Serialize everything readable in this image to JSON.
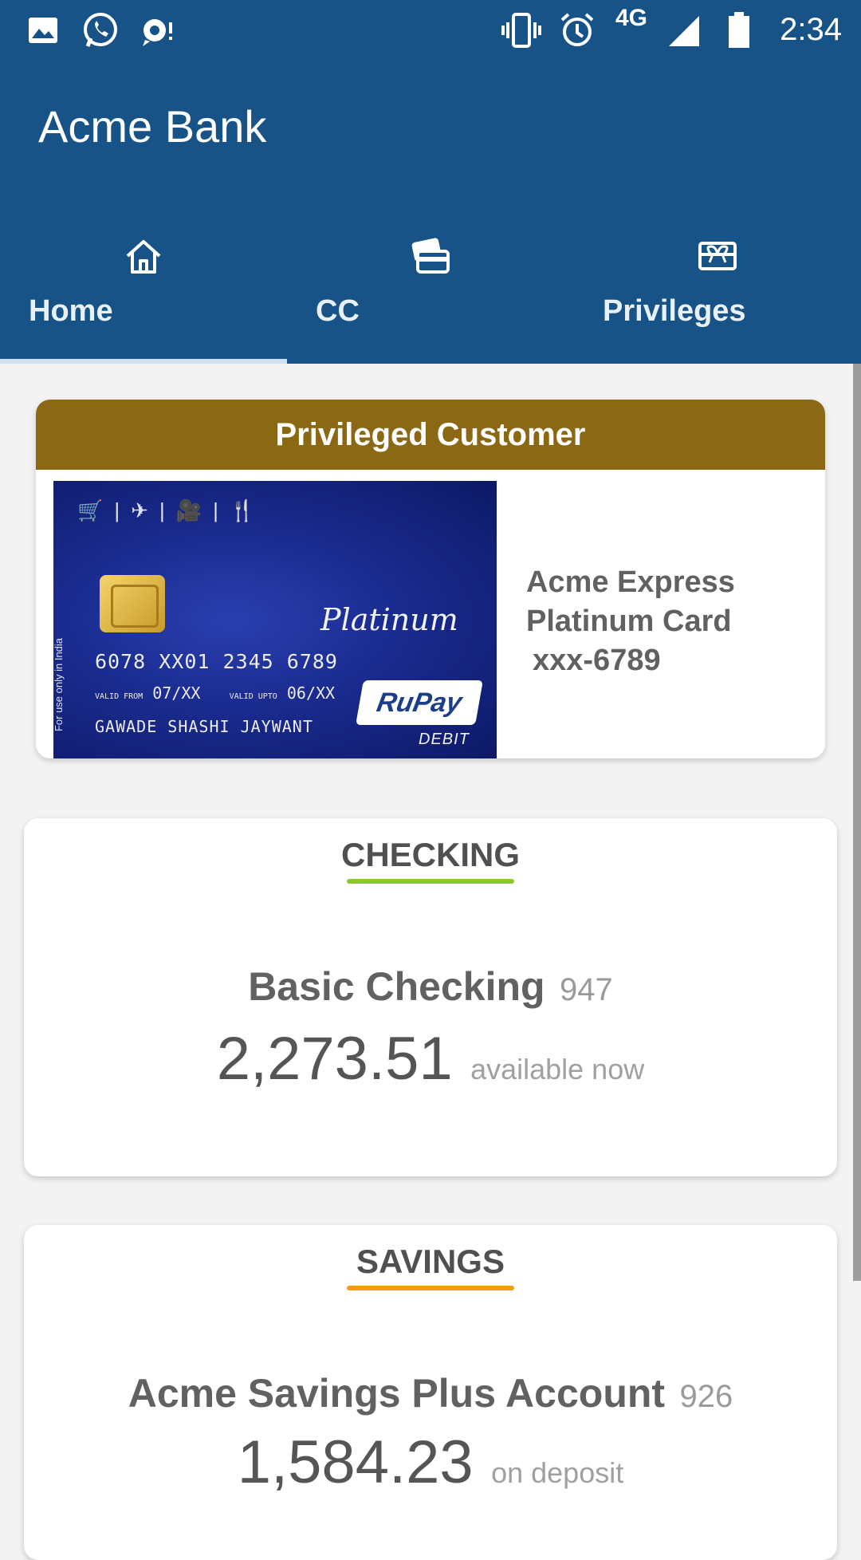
{
  "status_bar": {
    "time": "2:34",
    "network": "4G",
    "left_icons": [
      "image-icon",
      "whatsapp-icon",
      "chat-bubble-icon"
    ],
    "right_icons": [
      "vibrate-icon",
      "alarm-icon",
      "signal-icon",
      "battery-icon"
    ]
  },
  "app": {
    "title": "Acme Bank"
  },
  "tabs": [
    {
      "label": "Home",
      "icon": "home-icon",
      "selected": true
    },
    {
      "label": "CC",
      "icon": "credit-cards-icon",
      "selected": false
    },
    {
      "label": "Privileges",
      "icon": "gift-card-icon",
      "selected": false
    }
  ],
  "privileged": {
    "header": "Privileged Customer",
    "card_line1": "Acme Express",
    "card_line2": "Platinum Card",
    "card_line3": "xxx-6789",
    "card_image": {
      "number": "6078 XX01 2345 6789",
      "valid_from_label": "VALID FROM",
      "valid_from": "07/XX",
      "valid_upto_label": "VALID UPTO",
      "valid_upto": "06/XX",
      "holder": "GAWADE SHASHI JAYWANT",
      "tier": "Platinum",
      "brand": "RuPay",
      "type": "DEBIT",
      "side_text": "For use only in India"
    }
  },
  "checking": {
    "section": "CHECKING",
    "account_name": "Basic Checking",
    "account_suffix": "947",
    "amount": "2,273.51",
    "amount_note": "available now",
    "accent": "#8ac926"
  },
  "savings": {
    "section": "SAVINGS",
    "account_name": "Acme Savings Plus Account",
    "account_suffix": "926",
    "amount": "1,584.23",
    "amount_note": "on deposit",
    "accent": "#f39c12"
  },
  "colors": {
    "primary": "#175386",
    "gold": "#8b6914"
  }
}
